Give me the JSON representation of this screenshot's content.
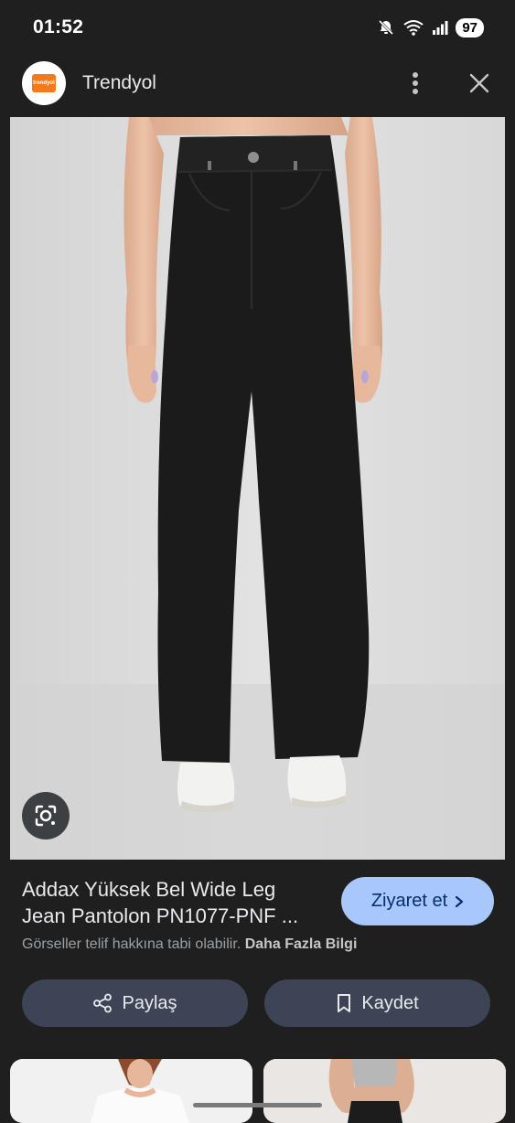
{
  "status_bar": {
    "time": "01:52",
    "battery": "97",
    "icons": [
      "mute-icon",
      "wifi-icon",
      "signal-icon",
      "battery-icon"
    ]
  },
  "header": {
    "site_name": "Trendyol",
    "logo_text": "trendyol",
    "logo_color": "#f27a1a",
    "menu_icon": "more-vert-icon",
    "close_icon": "close-icon"
  },
  "image": {
    "subject": "black-wide-leg-jeans"
  },
  "result": {
    "title_line1": "Addax Yüksek Bel Wide Leg",
    "title_line2": "Jean Pantolon PN1077-PNF ...",
    "visit_label": "Ziyaret et",
    "copyright_text": "Görseller telif hakkına tabi olabilir.",
    "more_info_label": "Daha Fazla Bilgi"
  },
  "actions": {
    "share_label": "Paylaş",
    "save_label": "Kaydet"
  },
  "colors": {
    "background": "#1f1f1f",
    "visit_button": "#a8c7fa",
    "action_button": "#3c4455"
  }
}
